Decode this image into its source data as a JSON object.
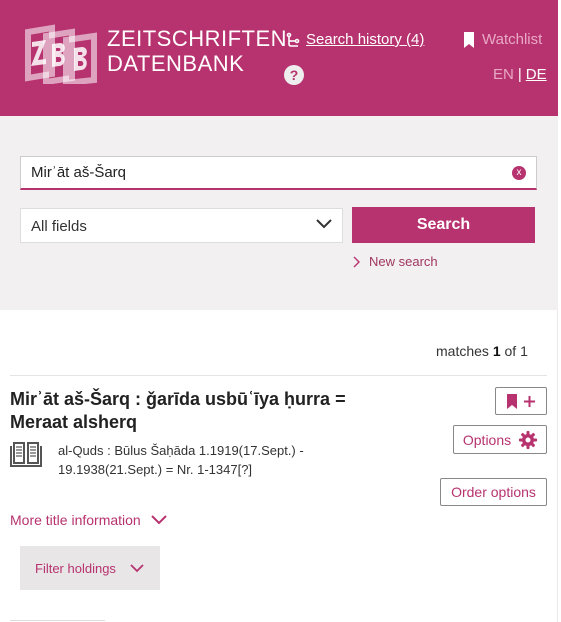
{
  "header": {
    "logo_line1": "ZEITSCHRIFTEN",
    "logo_line2": "DATENBANK",
    "search_history": "Search history (4)",
    "watchlist": "Watchlist",
    "help": "?",
    "lang_en": "EN",
    "lang_sep": "|",
    "lang_de": "DE"
  },
  "search": {
    "query": "Mirʾāt aš-Šarq",
    "clear": "x",
    "field_select": "All fields",
    "button": "Search",
    "new_search": "New search"
  },
  "results": {
    "matches_prefix": "matches",
    "matches_current": "1",
    "matches_of": "of 1",
    "item": {
      "title": "Mirʾāt aš-Šarq : ǧarīda usbūʿīya ḥurra = Meraat alsherq",
      "publication": "al-Quds : Būlus Šaḥāda 1.1919(17.Sept.) - 19.1938(21.Sept.) = Nr. 1-1347[?]",
      "options": "Options",
      "order_options": "Order options",
      "more_info": "More title information"
    },
    "filter_holdings": "Filter holdings"
  },
  "colors": {
    "brand": "#b7336f",
    "panel": "#f2f0f0"
  }
}
